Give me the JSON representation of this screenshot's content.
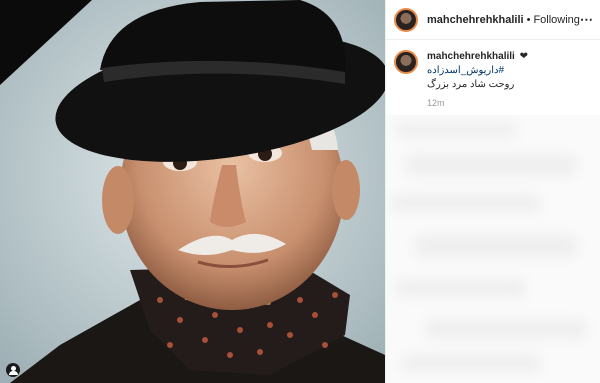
{
  "post": {
    "username": "mahchehrehkhalili",
    "follow_label": "Following",
    "separator": "•",
    "more_icon": "⋯",
    "caption_user": "mahchehrehkhalili",
    "caption_heart": "❤",
    "hashtag": "#داریوش_اسدزاده",
    "caption_line": "روحت شاد مرد بزرگ",
    "time_ago": "12m"
  },
  "colors": {
    "link": "#003569",
    "ring": "#e98a49",
    "muted": "#999999"
  }
}
